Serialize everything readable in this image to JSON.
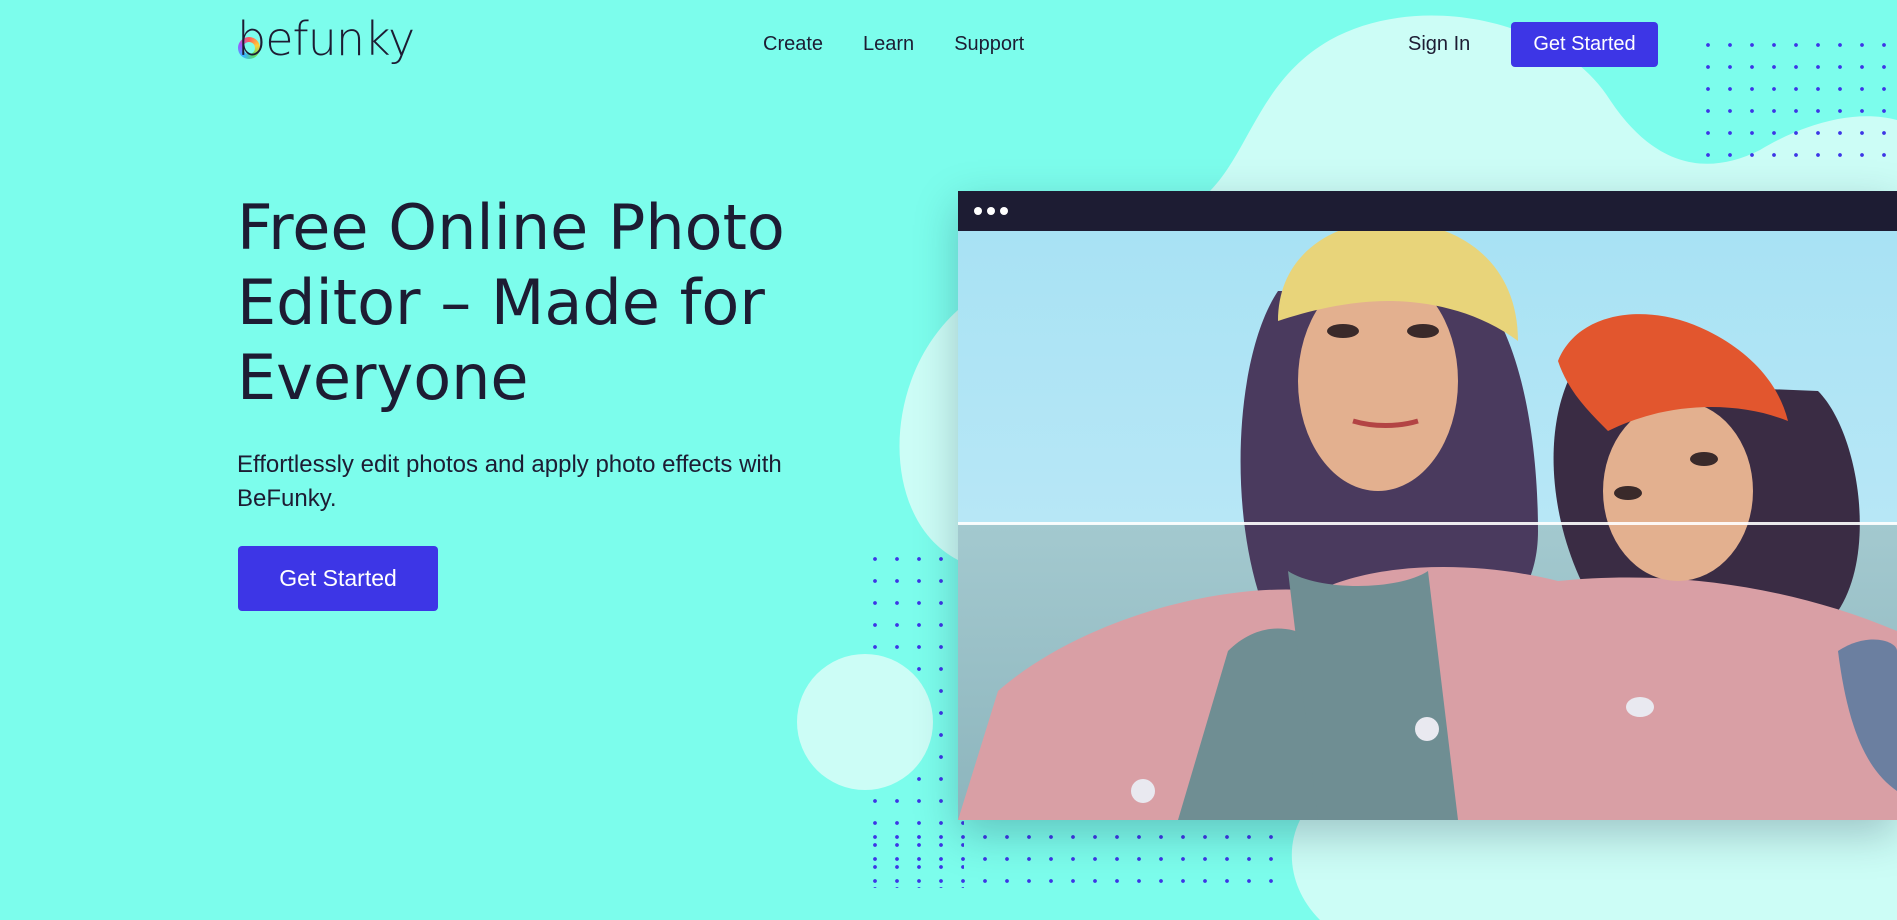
{
  "header": {
    "logo_text": "befunky",
    "nav": [
      "Create",
      "Learn",
      "Support"
    ],
    "sign_in": "Sign In",
    "cta": "Get Started"
  },
  "hero": {
    "title": "Free Online Photo Editor – Made for Everyone",
    "subtitle": "Effortlessly edit photos and apply photo effects with BeFunky.",
    "cta": "Get Started"
  },
  "colors": {
    "background": "#7cfdec",
    "accent": "#3d36e6",
    "text": "#1d1c33",
    "blob": "#ccfdf6"
  }
}
